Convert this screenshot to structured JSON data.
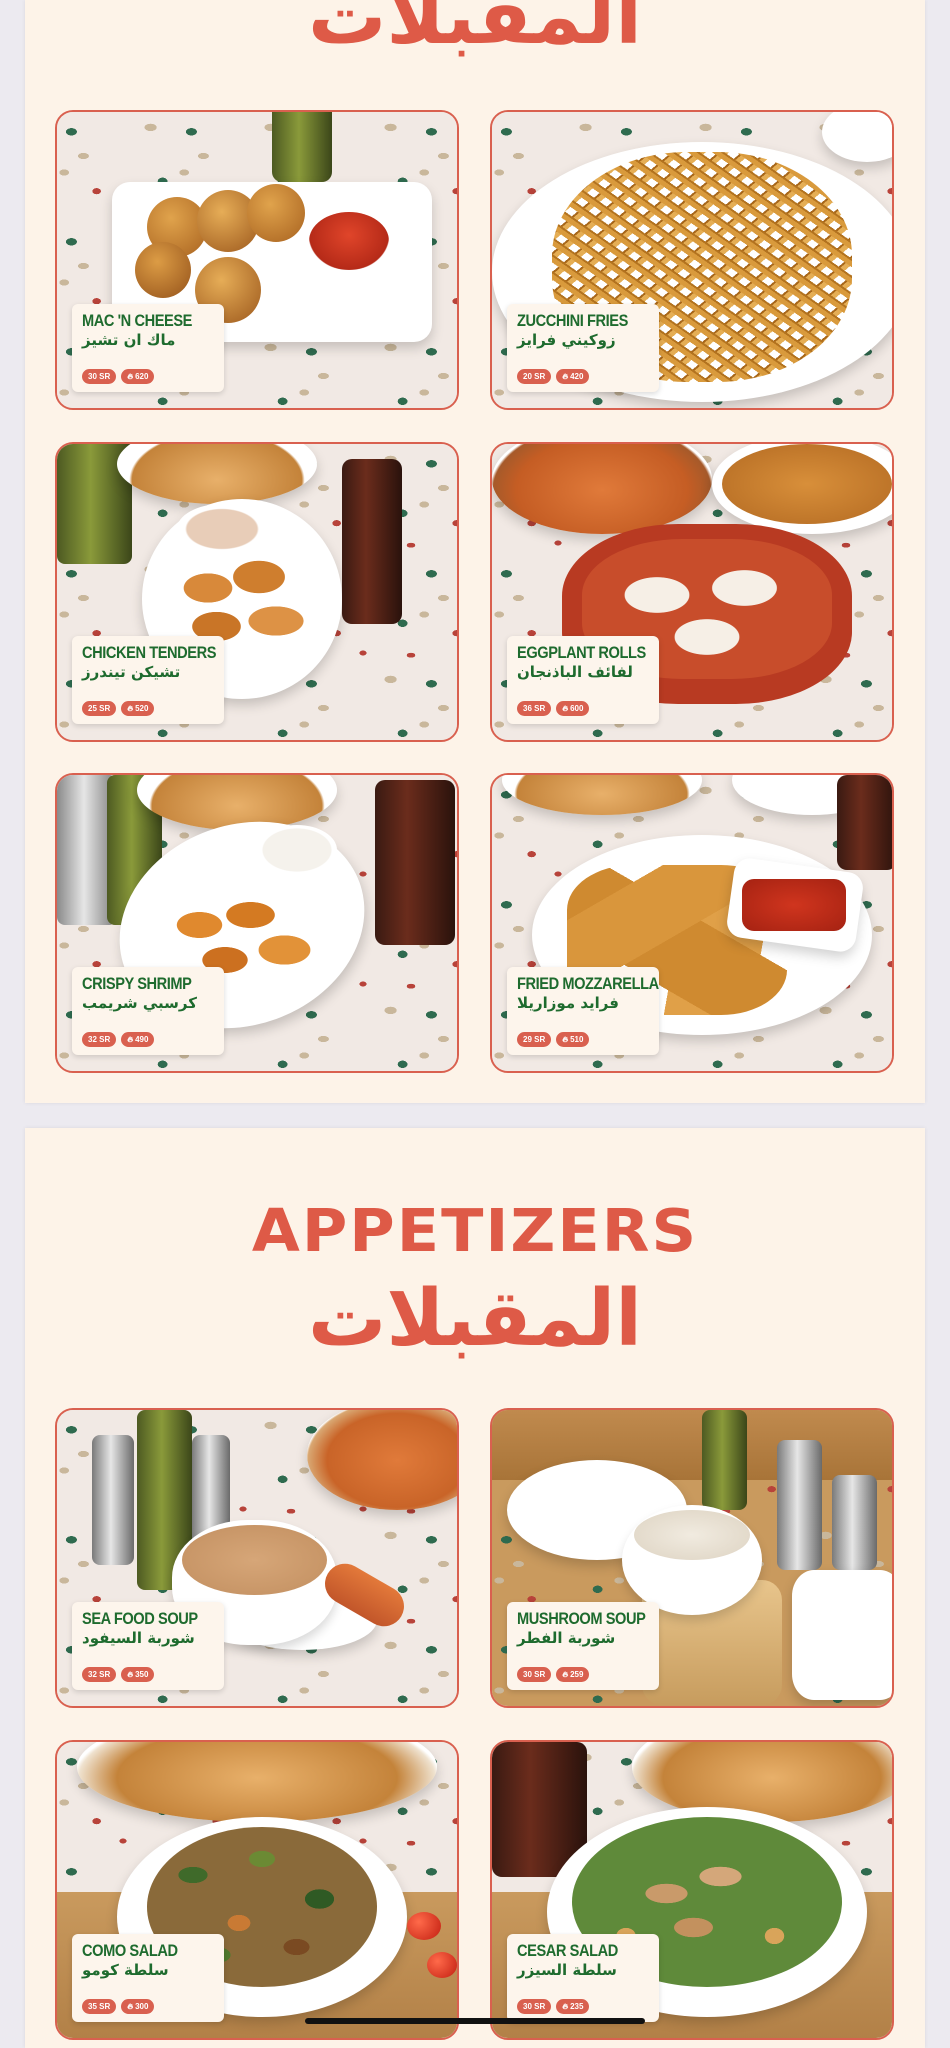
{
  "pages": [
    {
      "heading_en": "",
      "heading_ar": "المقبلات",
      "items": [
        {
          "name_en": "MAC 'N CHEESE",
          "name_ar": "ماك ان تشيز",
          "price": "30 SR",
          "calories": "620"
        },
        {
          "name_en": "ZUCCHINI FRIES",
          "name_ar": "زوكيني فرايز",
          "price": "20 SR",
          "calories": "420"
        },
        {
          "name_en": "CHICKEN TENDERS",
          "name_ar": "تشيكن تيندرز",
          "price": "25 SR",
          "calories": "520"
        },
        {
          "name_en": "EGGPLANT ROLLS",
          "name_ar": "لفائف الباذنجان",
          "price": "36 SR",
          "calories": "600"
        },
        {
          "name_en": "CRISPY SHRIMP",
          "name_ar": "كرسبي شريمب",
          "price": "32 SR",
          "calories": "490"
        },
        {
          "name_en": "FRIED MOZZARELLA",
          "name_ar": "فرايد موزاريلا",
          "price": "29 SR",
          "calories": "510"
        }
      ]
    },
    {
      "heading_en": "APPETIZERS",
      "heading_ar": "المقبلات",
      "items": [
        {
          "name_en": "SEA FOOD SOUP",
          "name_ar": "شوربة السيفود",
          "price": "32 SR",
          "calories": "350"
        },
        {
          "name_en": "MUSHROOM SOUP",
          "name_ar": "شوربة الفطر",
          "price": "30 SR",
          "calories": "259"
        },
        {
          "name_en": "COMO SALAD",
          "name_ar": "سلطة كومو",
          "price": "35 SR",
          "calories": "300"
        },
        {
          "name_en": "CESAR SALAD",
          "name_ar": "سلطة السيزر",
          "price": "30 SR",
          "calories": "235"
        }
      ]
    }
  ],
  "icons": {
    "calorie_icon": "flame-icon"
  },
  "colors": {
    "accent": "#de5a47",
    "item_text": "#1e6b2e",
    "background": "#fdf3e8"
  }
}
